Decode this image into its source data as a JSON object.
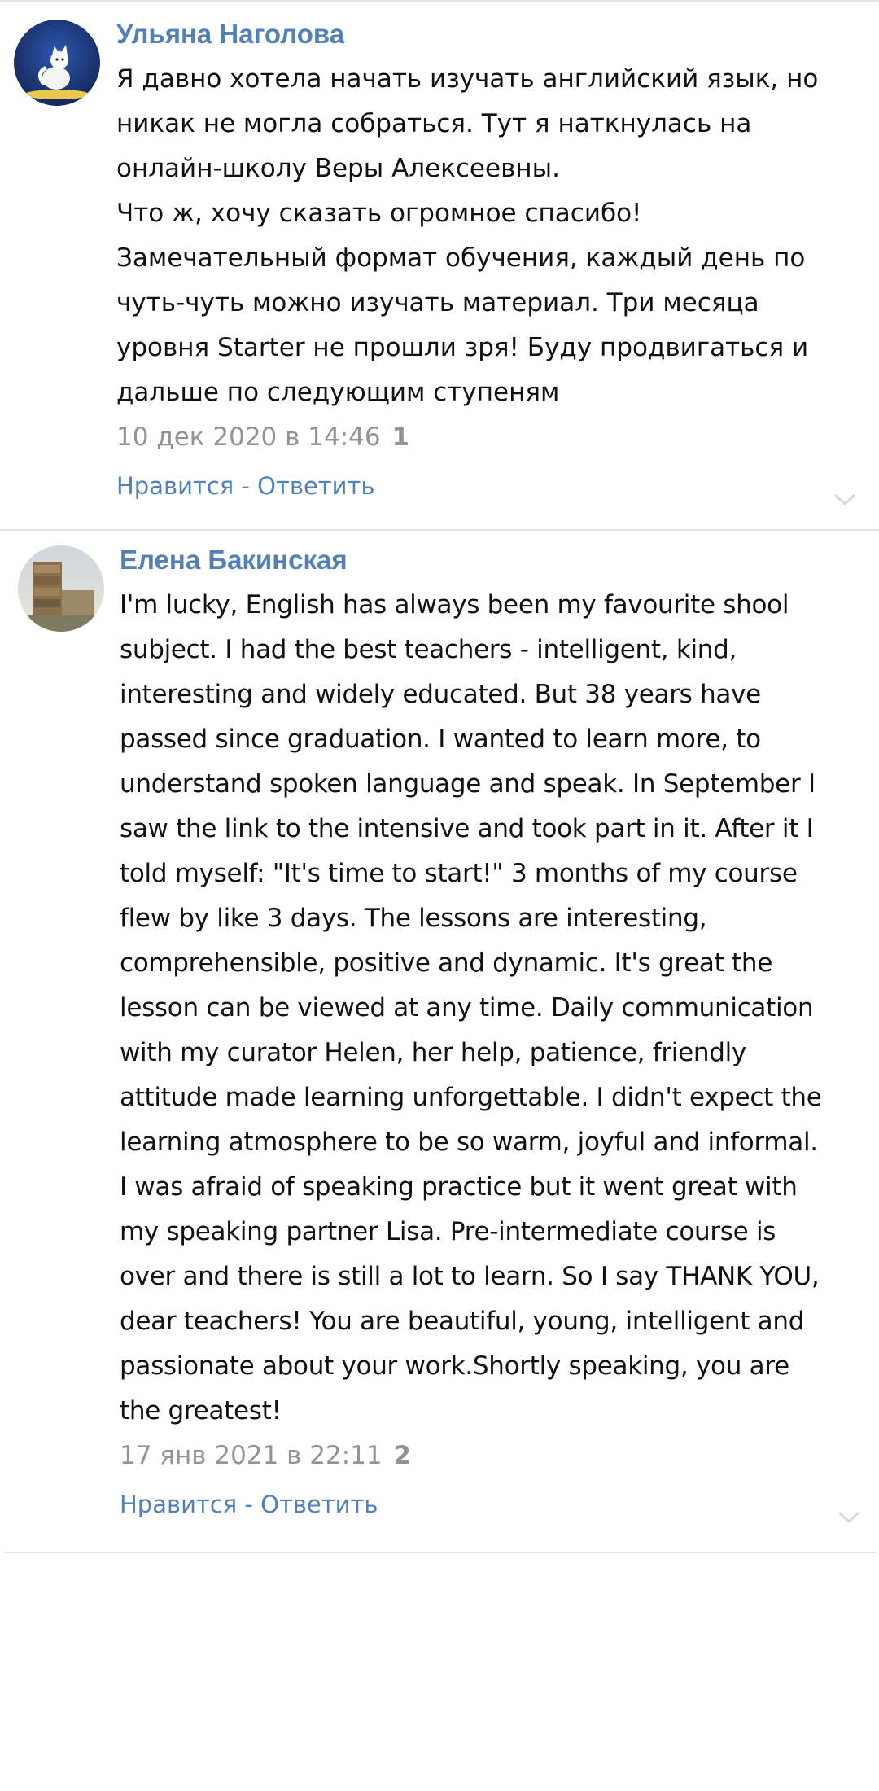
{
  "comments": [
    {
      "author": "Ульяна Наголова",
      "avatar_icon": "white-cat-avatar",
      "text": "Я давно хотела начать изучать английский язык, но\nникак не могла собраться. Тут я наткнулась на\nонлайн-школу Веры Алексеевны.\nЧто ж, хочу сказать огромное спасибо!\nЗамечательный формат обучения, каждый день по\nчуть-чуть можно изучать материал. Три месяца\nуровня Starter не прошли зря! Буду продвигаться и\nдальше по следующим ступеням",
      "date": "10 дек 2020 в 14:46",
      "likes": "1",
      "like_label": "Нравится",
      "separator": " - ",
      "reply_label": "Ответить"
    },
    {
      "author": "Елена Бакинская",
      "avatar_icon": "stone-wall-avatar",
      "text": "I'm lucky, English has always been my favourite shool\nsubject. I had the best teachers - intelligent, kind,\ninteresting and widely educated. But 38 years have\npassed since graduation. I wanted to learn more, to\nunderstand spoken language and speak. In September I\nsaw the link to the intensive and took part in it. After it I\ntold myself: \"It's time to start!\" 3 months of my course\nflew by like 3 days. The lessons are interesting,\ncomprehensible, positive and dynamic. It's great the\nlesson can be viewed at any time. Daily communication\nwith my curator Helen, her help, patience, friendly\nattitude made learning unforgettable. I didn't expect the\nlearning atmosphere to be so warm, joyful and informal.\nI was afraid of speaking practice but it went great with\nmy speaking partner Lisa. Pre-intermediate course is\nover and there is still a lot to learn. So I say THANK YOU,\ndear teachers! You are beautiful, young, intelligent and\npassionate about your work.Shortly speaking, you are\nthe greatest!",
      "date": "17 янв 2021 в 22:11",
      "likes": "2",
      "like_label": "Нравится",
      "separator": " - ",
      "reply_label": "Ответить"
    }
  ],
  "colors": {
    "link": "#5181b8",
    "meta": "#939393",
    "divider": "#e3e4e8"
  },
  "icons": {
    "expand": "chevron-down-icon"
  }
}
